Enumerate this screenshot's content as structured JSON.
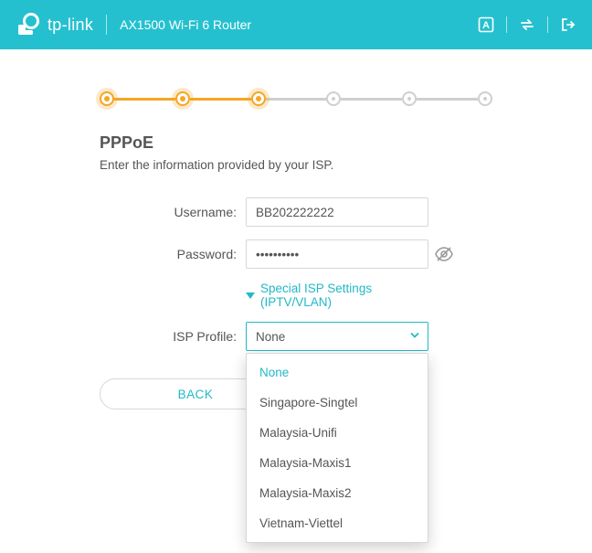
{
  "header": {
    "brand": "tp-link",
    "device": "AX1500 Wi-Fi 6 Router"
  },
  "stepper": {
    "total": 6,
    "current": 3
  },
  "page": {
    "title": "PPPoE",
    "subtitle": "Enter the information provided by your ISP."
  },
  "form": {
    "username_label": "Username:",
    "username_value": "BB202222222",
    "password_label": "Password:",
    "password_value": "••••••••••",
    "special_link": "Special ISP Settings (IPTV/VLAN)",
    "isp_label": "ISP Profile:",
    "isp_selected": "None",
    "isp_options": [
      "None",
      "Singapore-Singtel",
      "Malaysia-Unifi",
      "Malaysia-Maxis1",
      "Malaysia-Maxis2",
      "Vietnam-Viettel"
    ]
  },
  "buttons": {
    "back": "BACK"
  }
}
